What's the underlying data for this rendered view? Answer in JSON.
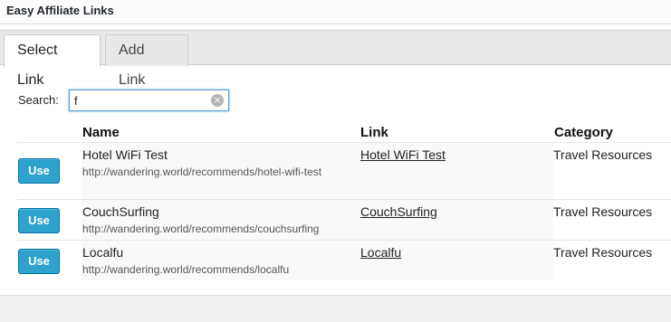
{
  "window": {
    "title": "Easy Affiliate Links"
  },
  "tabs": [
    {
      "label": "Select Link",
      "active": true
    },
    {
      "label": "Add Link",
      "active": false
    }
  ],
  "search": {
    "label": "Search:",
    "value": "f",
    "clear_icon": "clear-circle-icon"
  },
  "table": {
    "headers": {
      "name": "Name",
      "link": "Link",
      "category": "Category"
    },
    "use_label": "Use",
    "rows": [
      {
        "name": "Hotel WiFi Test",
        "url": "http://wandering.world/recommends/hotel-wifi-test",
        "link": "Hotel WiFi Test",
        "category": "Travel Resources"
      },
      {
        "name": "CouchSurfing",
        "url": "http://wandering.world/recommends/couchsurfing",
        "link": "CouchSurfing",
        "category": "Travel Resources"
      },
      {
        "name": "Localfu",
        "url": "http://wandering.world/recommends/localfu",
        "link": "Localfu",
        "category": "Travel Resources"
      }
    ]
  },
  "colors": {
    "accent": "#2ea2cc",
    "accent_border": "#0074a2",
    "focus": "#5b9dd9"
  }
}
